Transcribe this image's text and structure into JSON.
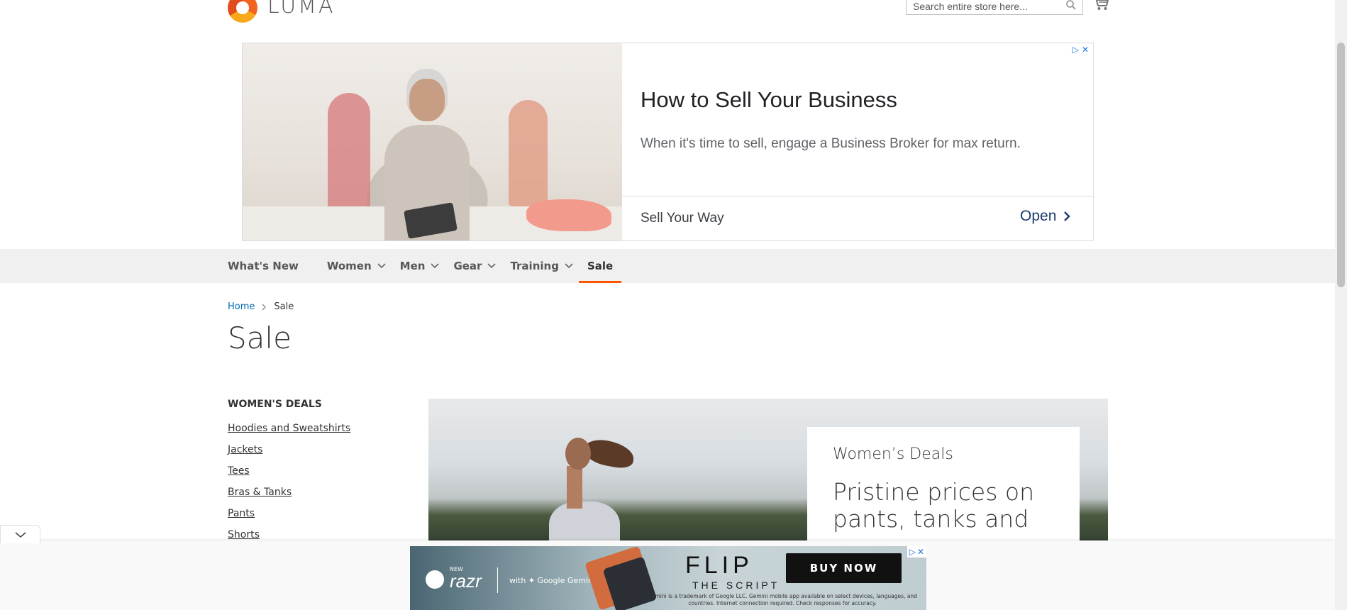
{
  "header": {
    "logo_text": "LUMA",
    "search_placeholder": "Search entire store here..."
  },
  "top_ad": {
    "headline": "How to Sell Your Business",
    "description": "When it's time to sell, engage a Business Broker for max return.",
    "sub": "Sell Your Way",
    "cta": "Open"
  },
  "nav": {
    "items": [
      {
        "label": "What's New",
        "dropdown": false
      },
      {
        "label": "Women",
        "dropdown": true
      },
      {
        "label": "Men",
        "dropdown": true
      },
      {
        "label": "Gear",
        "dropdown": true
      },
      {
        "label": "Training",
        "dropdown": true
      },
      {
        "label": "Sale",
        "dropdown": false,
        "active": true
      }
    ]
  },
  "breadcrumb": {
    "home": "Home",
    "current": "Sale"
  },
  "page": {
    "title": "Sale"
  },
  "sidebar": {
    "heading": "WOMEN'S DEALS",
    "items": [
      "Hoodies and Sweatshirts",
      "Jackets",
      "Tees",
      "Bras & Tanks",
      "Pants",
      "Shorts"
    ]
  },
  "hero": {
    "kicker": "Women’s Deals",
    "title": "Pristine prices on pants, tanks and"
  },
  "bottom_ad": {
    "new": "NEW",
    "brand": "razr",
    "partner": "with ✦ Google Gemini",
    "headline": "FLIP",
    "subline": "THE SCRIPT",
    "fine_print": "Gemini is a trademark of Google LLC. Gemini mobile app available on select devices, languages, and countries. Internet connection required. Check responses for accuracy.",
    "cta": "BUY NOW"
  },
  "colors": {
    "accent": "#ff5501",
    "link": "#006bb4",
    "nav_bg": "#f0f0f0"
  }
}
